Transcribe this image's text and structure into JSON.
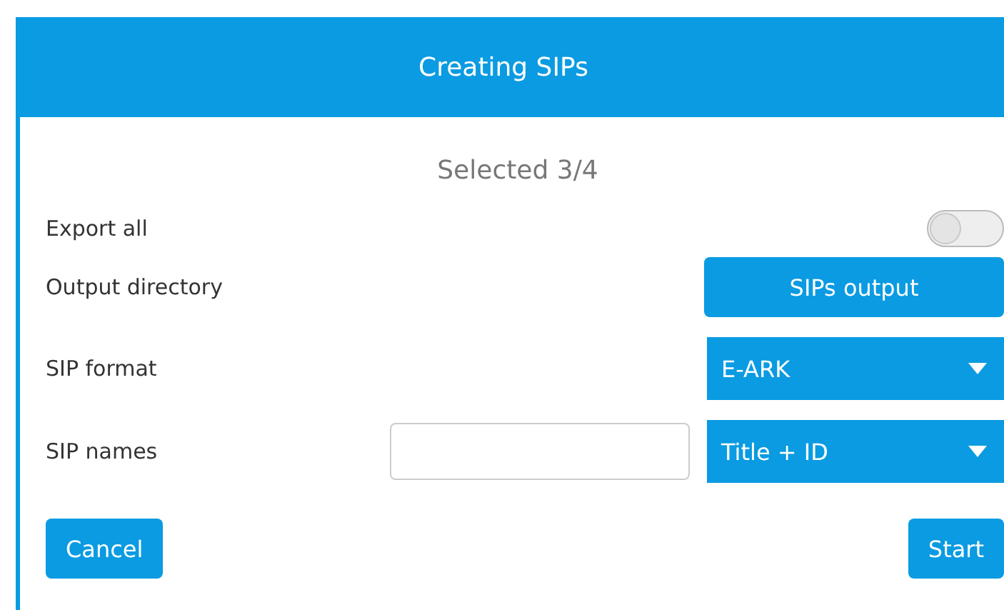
{
  "dialog": {
    "title": "Creating SIPs",
    "subtitle": "Selected 3/4"
  },
  "fields": [
    {
      "kind": "toggle",
      "label": "Export all",
      "on": false
    },
    {
      "kind": "button",
      "label": "Output directory",
      "button": "SIPs output"
    },
    {
      "kind": "select",
      "label": "SIP format",
      "value": "E-ARK"
    },
    {
      "kind": "text-select",
      "label": "SIP names",
      "value": "Title + ID"
    }
  ],
  "buttons": {
    "cancel": "Cancel",
    "confirm": "Start"
  }
}
